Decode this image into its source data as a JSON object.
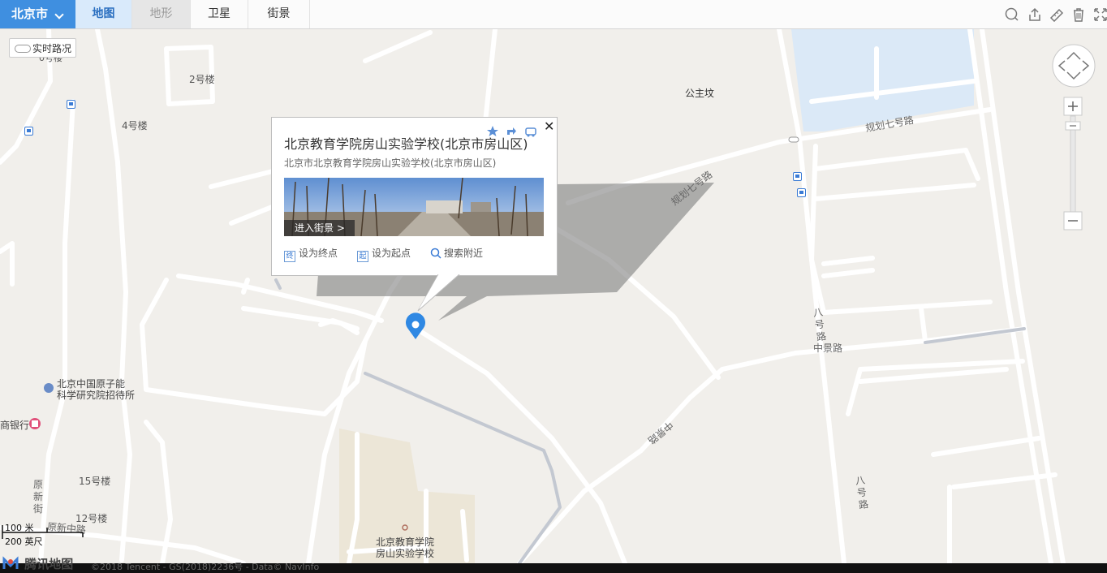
{
  "toolbar": {
    "city": "北京市",
    "tabs": [
      "地图",
      "地形",
      "卫星",
      "街景"
    ]
  },
  "traffic": {
    "label": "实时路况"
  },
  "labels": {
    "b2": "2号楼",
    "b4": "4号楼",
    "b0": "0号楼",
    "princess": "公主坟",
    "b15": "15号楼",
    "b12": "12号楼",
    "hotel1": "北京中国原子能",
    "hotel2": "科学研究院招待所",
    "bank": "商银行",
    "school1": "北京教育学院",
    "school2": "房山实验学校"
  },
  "roads": {
    "gh7a": "规划七号路",
    "gh7b": "规划七号路",
    "zjl": "中景路",
    "zjl2": "中景路",
    "b8a": "八号路",
    "b8b": "八号路",
    "yxj": "原新街",
    "yxzl": "原新中路"
  },
  "popup": {
    "title": "北京教育学院房山实验学校(北京市房山区)",
    "address": "北京市北京教育学院房山实验学校(北京市房山区)",
    "streetview": "进入街景 >",
    "actions": [
      {
        "icon": "终",
        "label": "设为终点"
      },
      {
        "icon": "起",
        "label": "设为起点"
      },
      {
        "icon": "search",
        "label": "搜索附近"
      }
    ],
    "close": "✕"
  },
  "scale": {
    "metric": "100 米",
    "imperial": "200 英尺"
  },
  "footer": {
    "logo": "腾讯地图",
    "copyright": "©2018 Tencent - GS(2018)2236号 - Data© NavInfo"
  }
}
